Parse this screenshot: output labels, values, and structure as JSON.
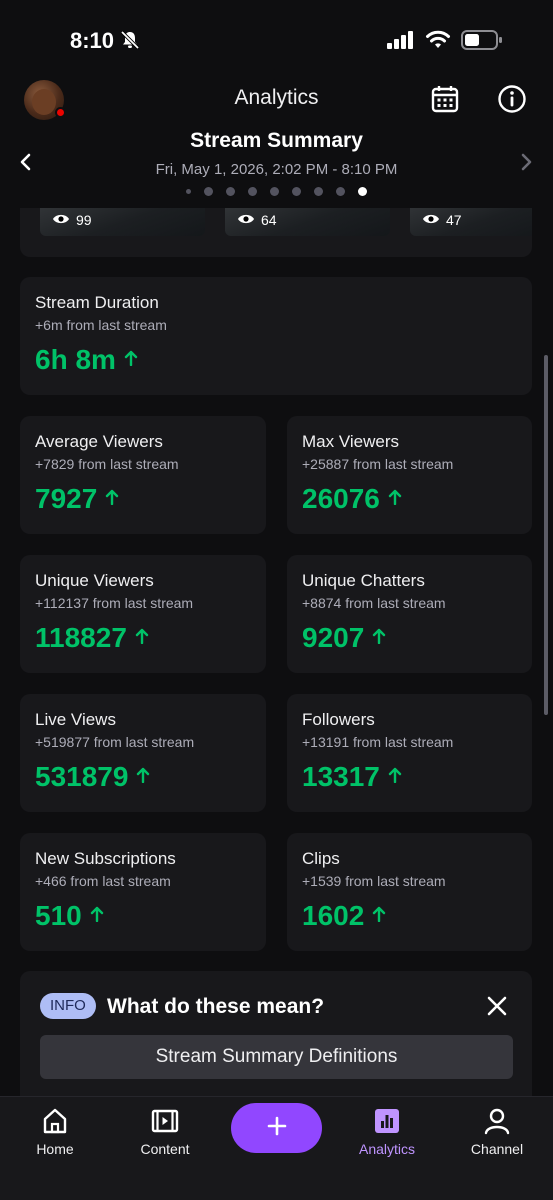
{
  "status_bar": {
    "time": "8:10"
  },
  "header": {
    "title": "Analytics"
  },
  "summary": {
    "title": "Stream Summary",
    "date_range": "Fri, May 1, 2026, 2:02 PM - 8:10 PM",
    "page_count": 9,
    "active_page": 9
  },
  "clips": [
    {
      "views": "99"
    },
    {
      "views": "64"
    },
    {
      "views": "47"
    }
  ],
  "stats": {
    "stream_duration": {
      "label": "Stream Duration",
      "change": "+6m from last stream",
      "value": "6h 8m"
    },
    "average_viewers": {
      "label": "Average Viewers",
      "change": "+7829 from last stream",
      "value": "7927"
    },
    "max_viewers": {
      "label": "Max Viewers",
      "change": "+25887 from last stream",
      "value": "26076"
    },
    "unique_viewers": {
      "label": "Unique Viewers",
      "change": "+112137 from last stream",
      "value": "118827"
    },
    "unique_chatters": {
      "label": "Unique Chatters",
      "change": "+8874 from last stream",
      "value": "9207"
    },
    "live_views": {
      "label": "Live Views",
      "change": "+519877 from last stream",
      "value": "531879"
    },
    "followers": {
      "label": "Followers",
      "change": "+13191 from last stream",
      "value": "13317"
    },
    "new_subscriptions": {
      "label": "New Subscriptions",
      "change": "+466 from last stream",
      "value": "510"
    },
    "clips": {
      "label": "Clips",
      "change": "+1539 from last stream",
      "value": "1602"
    }
  },
  "info": {
    "badge": "INFO",
    "heading": "What do these mean?",
    "button_label": "Stream Summary Definitions"
  },
  "nav": {
    "home": "Home",
    "content": "Content",
    "analytics": "Analytics",
    "channel": "Channel"
  },
  "colors": {
    "background": "#0e0e10",
    "card": "#18181b",
    "positive": "#00c268",
    "accent": "#9147ff",
    "active_nav": "#bf94ff",
    "info_badge": "#aebdf5"
  }
}
